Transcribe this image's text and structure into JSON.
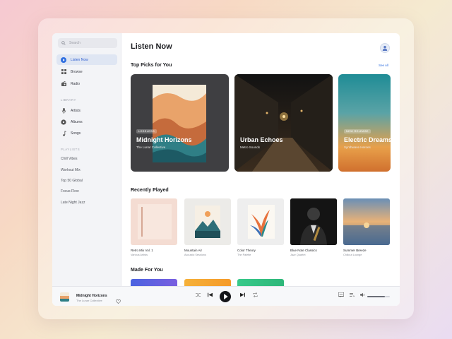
{
  "search": {
    "placeholder": "Search"
  },
  "sidebar": {
    "nav": [
      {
        "label": "Listen Now",
        "icon": "play-circle-icon",
        "active": true
      },
      {
        "label": "Browse",
        "icon": "grid-icon",
        "active": false
      },
      {
        "label": "Radio",
        "icon": "radio-icon",
        "active": false
      }
    ],
    "library_label": "LIBRARY",
    "library": [
      {
        "label": "Artists",
        "icon": "microphone-icon"
      },
      {
        "label": "Albums",
        "icon": "album-icon"
      },
      {
        "label": "Songs",
        "icon": "music-note-icon"
      }
    ],
    "playlists_label": "PLAYLISTS",
    "playlists": [
      "Chill Vibes",
      "Workout Mix",
      "Top 50 Global",
      "Focus Flow",
      "Late Night Jazz"
    ]
  },
  "main": {
    "title": "Listen Now",
    "top_picks_title": "Top Picks for You",
    "see_all": "See All",
    "top_picks": [
      {
        "title": "Midnight Horizons",
        "subtitle": "The Lunar Collective",
        "badge": "LOSSLESS"
      },
      {
        "title": "Urban Echoes",
        "subtitle": "Metro Sounds",
        "badge": ""
      },
      {
        "title": "Electric Dreams",
        "subtitle": "Synthwave Heroes",
        "badge": "NEW RELEASE"
      }
    ],
    "recently_title": "Recently Played",
    "recent": [
      {
        "title": "Retro Mix Vol. 1",
        "artist": "Various Artists"
      },
      {
        "title": "Mountain Air",
        "artist": "Acoustic Sessions"
      },
      {
        "title": "Color Theory",
        "artist": "The Palette"
      },
      {
        "title": "Blue Note Classics",
        "artist": "Jazz Quartet"
      },
      {
        "title": "Summer Breeze",
        "artist": "Chillout Lounge"
      }
    ],
    "made_title": "Made For You"
  },
  "player": {
    "title": "Midnight Horizons",
    "artist": "The Lunar Collective",
    "volume": 0.78
  },
  "colors": {
    "accent": "#2f6fe0",
    "play": "#15161a"
  }
}
